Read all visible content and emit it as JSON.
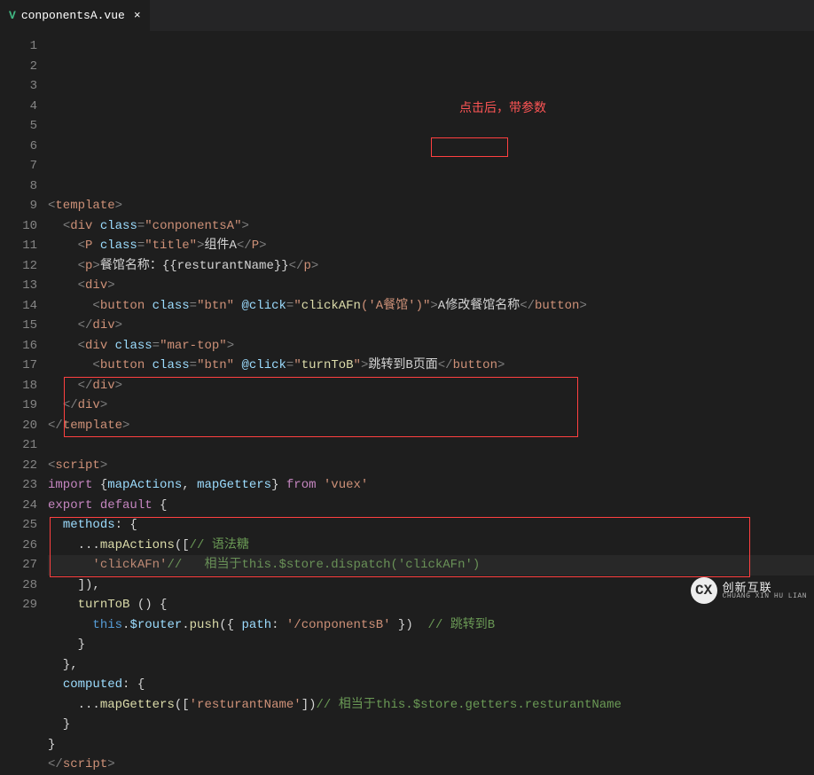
{
  "tab": {
    "filename": "conponentsA.vue"
  },
  "annotation": {
    "text": "点击后，带参数"
  },
  "watermark": {
    "logo": "CX",
    "cn": "创新互联",
    "py": "CHUANG XIN HU LIAN"
  },
  "lines": [
    {
      "n": 1,
      "segs": [
        [
          "<",
          "p"
        ],
        [
          "template",
          "t"
        ],
        [
          ">",
          "p"
        ]
      ]
    },
    {
      "n": 2,
      "segs": [
        [
          "  ",
          ""
        ],
        [
          "<",
          "p"
        ],
        [
          "div",
          "t"
        ],
        [
          " ",
          ""
        ],
        [
          "class",
          "a"
        ],
        [
          "=",
          "p"
        ],
        [
          "\"conponentsA\"",
          "s"
        ],
        [
          ">",
          "p"
        ]
      ]
    },
    {
      "n": 3,
      "segs": [
        [
          "    ",
          ""
        ],
        [
          "<",
          "p"
        ],
        [
          "P",
          "t"
        ],
        [
          " ",
          ""
        ],
        [
          "class",
          "a"
        ],
        [
          "=",
          "p"
        ],
        [
          "\"title\"",
          "s"
        ],
        [
          ">",
          "p"
        ],
        [
          "组件A",
          "x"
        ],
        [
          "</",
          "p"
        ],
        [
          "P",
          "t"
        ],
        [
          ">",
          "p"
        ]
      ]
    },
    {
      "n": 4,
      "segs": [
        [
          "    ",
          ""
        ],
        [
          "<",
          "p"
        ],
        [
          "p",
          "t"
        ],
        [
          ">",
          "p"
        ],
        [
          "餐馆名称：{{resturantName}}",
          "x"
        ],
        [
          "</",
          "p"
        ],
        [
          "p",
          "t"
        ],
        [
          ">",
          "p"
        ]
      ]
    },
    {
      "n": 5,
      "segs": [
        [
          "    ",
          ""
        ],
        [
          "<",
          "p"
        ],
        [
          "div",
          "t"
        ],
        [
          ">",
          "p"
        ]
      ]
    },
    {
      "n": 6,
      "segs": [
        [
          "      ",
          ""
        ],
        [
          "<",
          "p"
        ],
        [
          "button",
          "t"
        ],
        [
          " ",
          ""
        ],
        [
          "class",
          "a"
        ],
        [
          "=",
          "p"
        ],
        [
          "\"btn\"",
          "s"
        ],
        [
          " ",
          ""
        ],
        [
          "@click",
          "a"
        ],
        [
          "=",
          "p"
        ],
        [
          "\"",
          "s"
        ],
        [
          "clickAFn",
          "y"
        ],
        [
          "(",
          "s"
        ],
        [
          "'A餐馆'",
          "s"
        ],
        [
          ")",
          "s"
        ],
        [
          "\"",
          "s"
        ],
        [
          ">",
          "p"
        ],
        [
          "A修改餐馆名称",
          "x"
        ],
        [
          "</",
          "p"
        ],
        [
          "button",
          "t"
        ],
        [
          ">",
          "p"
        ]
      ]
    },
    {
      "n": 7,
      "segs": [
        [
          "    ",
          ""
        ],
        [
          "</",
          "p"
        ],
        [
          "div",
          "t"
        ],
        [
          ">",
          "p"
        ]
      ]
    },
    {
      "n": 8,
      "segs": [
        [
          "    ",
          ""
        ],
        [
          "<",
          "p"
        ],
        [
          "div",
          "t"
        ],
        [
          " ",
          ""
        ],
        [
          "class",
          "a"
        ],
        [
          "=",
          "p"
        ],
        [
          "\"mar-top\"",
          "s"
        ],
        [
          ">",
          "p"
        ]
      ]
    },
    {
      "n": 9,
      "segs": [
        [
          "      ",
          ""
        ],
        [
          "<",
          "p"
        ],
        [
          "button",
          "t"
        ],
        [
          " ",
          ""
        ],
        [
          "class",
          "a"
        ],
        [
          "=",
          "p"
        ],
        [
          "\"btn\"",
          "s"
        ],
        [
          " ",
          ""
        ],
        [
          "@click",
          "a"
        ],
        [
          "=",
          "p"
        ],
        [
          "\"",
          "s"
        ],
        [
          "turnToB",
          "y"
        ],
        [
          "\"",
          "s"
        ],
        [
          ">",
          "p"
        ],
        [
          "跳转到B页面",
          "x"
        ],
        [
          "</",
          "p"
        ],
        [
          "button",
          "t"
        ],
        [
          ">",
          "p"
        ]
      ]
    },
    {
      "n": 10,
      "segs": [
        [
          "    ",
          ""
        ],
        [
          "</",
          "p"
        ],
        [
          "div",
          "t"
        ],
        [
          ">",
          "p"
        ]
      ]
    },
    {
      "n": 11,
      "segs": [
        [
          "  ",
          ""
        ],
        [
          "</",
          "p"
        ],
        [
          "div",
          "t"
        ],
        [
          ">",
          "p"
        ]
      ]
    },
    {
      "n": 12,
      "segs": [
        [
          "</",
          "p"
        ],
        [
          "template",
          "t"
        ],
        [
          ">",
          "p"
        ]
      ]
    },
    {
      "n": 13,
      "segs": [
        [
          "",
          ""
        ]
      ]
    },
    {
      "n": 14,
      "segs": [
        [
          "<",
          "p"
        ],
        [
          "script",
          "t"
        ],
        [
          ">",
          "p"
        ]
      ]
    },
    {
      "n": 15,
      "segs": [
        [
          "import",
          "kr"
        ],
        [
          " {",
          ""
        ],
        [
          "mapActions",
          "v"
        ],
        [
          ", ",
          ""
        ],
        [
          "mapGetters",
          "v"
        ],
        [
          "} ",
          ""
        ],
        [
          "from",
          "kr"
        ],
        [
          " ",
          ""
        ],
        [
          "'vuex'",
          "s"
        ]
      ]
    },
    {
      "n": 16,
      "segs": [
        [
          "export",
          "kr"
        ],
        [
          " ",
          ""
        ],
        [
          "default",
          "kr"
        ],
        [
          " {",
          ""
        ]
      ]
    },
    {
      "n": 17,
      "segs": [
        [
          "  ",
          ""
        ],
        [
          "methods",
          "v"
        ],
        [
          ": {",
          ""
        ]
      ]
    },
    {
      "n": 18,
      "segs": [
        [
          "    ",
          ""
        ],
        [
          "...",
          "w"
        ],
        [
          "mapActions",
          "y"
        ],
        [
          "([",
          "w"
        ],
        [
          "// 语法糖",
          "c"
        ]
      ]
    },
    {
      "n": 19,
      "segs": [
        [
          "      ",
          ""
        ],
        [
          "'clickAFn'",
          "s"
        ],
        [
          "//   相当于this.$store.dispatch('clickAFn')",
          "c"
        ]
      ]
    },
    {
      "n": 20,
      "segs": [
        [
          "    ]),",
          "w"
        ]
      ]
    },
    {
      "n": 21,
      "segs": [
        [
          "    ",
          ""
        ],
        [
          "turnToB",
          "y"
        ],
        [
          " () {",
          "w"
        ]
      ]
    },
    {
      "n": 22,
      "segs": [
        [
          "      ",
          ""
        ],
        [
          "this",
          "th"
        ],
        [
          ".",
          "w"
        ],
        [
          "$router",
          "v"
        ],
        [
          ".",
          "w"
        ],
        [
          "push",
          "y"
        ],
        [
          "({ ",
          "w"
        ],
        [
          "path",
          "v"
        ],
        [
          ": ",
          "w"
        ],
        [
          "'/conponentsB'",
          "s"
        ],
        [
          " })  ",
          "w"
        ],
        [
          "// 跳转到B",
          "c"
        ]
      ]
    },
    {
      "n": 23,
      "segs": [
        [
          "    }",
          "w"
        ]
      ]
    },
    {
      "n": 24,
      "segs": [
        [
          "  },",
          "w"
        ]
      ]
    },
    {
      "n": 25,
      "segs": [
        [
          "  ",
          ""
        ],
        [
          "computed",
          "v"
        ],
        [
          ": {",
          "w"
        ]
      ]
    },
    {
      "n": 26,
      "segs": [
        [
          "    ",
          ""
        ],
        [
          "...",
          "w"
        ],
        [
          "mapGetters",
          "y"
        ],
        [
          "([",
          "w"
        ],
        [
          "'resturantName'",
          "s"
        ],
        [
          "])",
          "w"
        ],
        [
          "// 相当于this.$store.getters.resturantName",
          "c"
        ]
      ]
    },
    {
      "n": 27,
      "segs": [
        [
          "  }",
          "w"
        ]
      ]
    },
    {
      "n": 28,
      "segs": [
        [
          "}",
          ""
        ]
      ]
    },
    {
      "n": 29,
      "segs": [
        [
          "</",
          "p"
        ],
        [
          "script",
          "t"
        ],
        [
          ">",
          "p"
        ]
      ]
    }
  ]
}
